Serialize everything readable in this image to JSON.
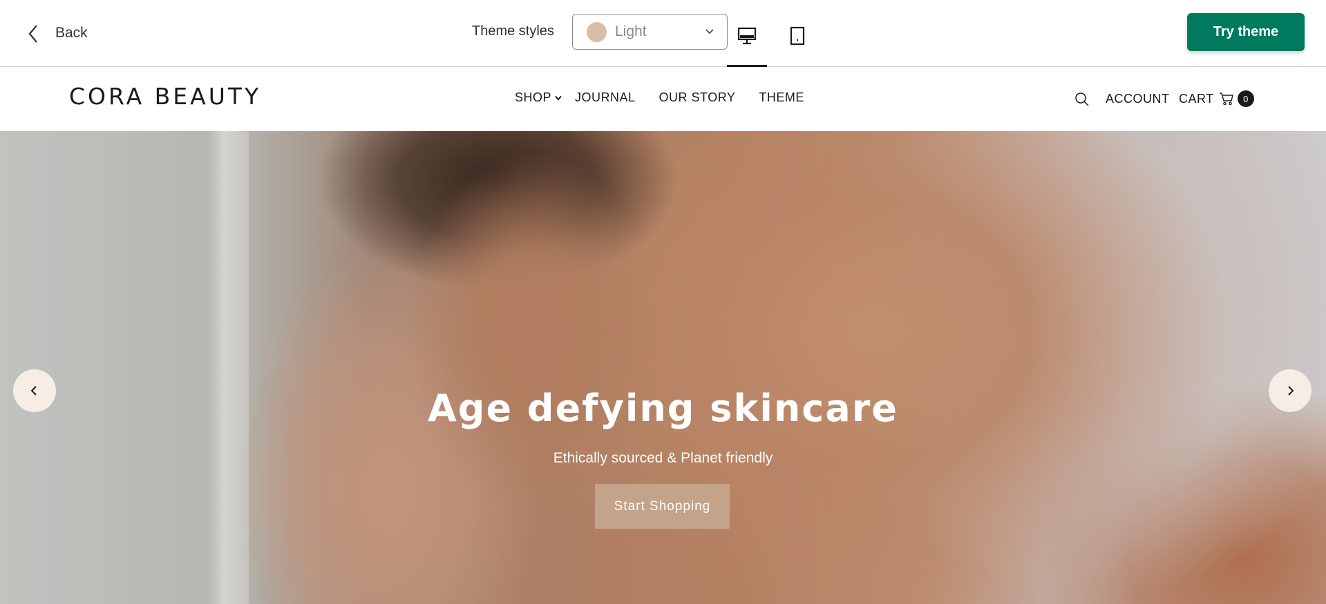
{
  "toolbar": {
    "back_label": "Back",
    "theme_styles_label": "Theme styles",
    "theme_style_value": "Light",
    "swatch_color": "#d9bda7",
    "desktop_icon": "desktop-icon",
    "mobile_icon": "mobile-icon",
    "try_theme_label": "Try theme",
    "try_theme_color": "#007a5f"
  },
  "store": {
    "logo": "CORA BEAUTY",
    "nav": [
      {
        "label": "SHOP",
        "has_dropdown": true
      },
      {
        "label": "JOURNAL"
      },
      {
        "label": "OUR STORY"
      },
      {
        "label": "THEME"
      }
    ],
    "search_icon": "search-icon",
    "account_label": "ACCOUNT",
    "cart_label": "CART",
    "cart_count": "0"
  },
  "hero": {
    "title": "Age defying skincare",
    "subtitle": "Ethically sourced & Planet friendly",
    "cta_label": "Start Shopping",
    "cta_color": "#c4a68c",
    "prev_icon": "chevron-left-icon",
    "next_icon": "chevron-right-icon"
  }
}
